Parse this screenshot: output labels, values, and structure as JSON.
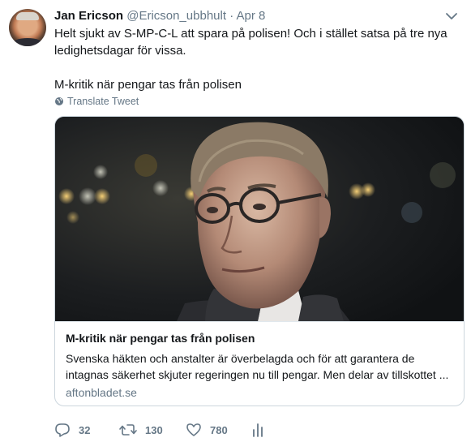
{
  "tweet": {
    "author_name": "Jan Ericson",
    "handle": "@Ericson_ubbhult",
    "separator": "·",
    "date": "Apr 8",
    "text_line1": "Helt sjukt av S-MP-C-L att spara på polisen! Och i stället satsa på tre nya",
    "text_line2": "ledighetsdagar för vissa.",
    "text_line3": "M-kritik när pengar tas från polisen",
    "translate_label": "Translate Tweet"
  },
  "card": {
    "title": "M-kritik när pengar tas från polisen",
    "description_line1": "Svenska häkten och anstalter är överbelagda och för att garantera de",
    "description_line2": "intagnas säkerhet skjuter regeringen nu till pengar. Men delar av tillskottet ...",
    "domain": "aftonbladet.se"
  },
  "actions": {
    "reply_count": "32",
    "retweet_count": "130",
    "like_count": "780"
  },
  "icons": {
    "caret": "chevron-down-icon",
    "translate": "globe-icon",
    "reply": "reply-icon",
    "retweet": "retweet-icon",
    "like": "heart-icon",
    "analytics": "analytics-icon"
  },
  "colors": {
    "text": "#14171a",
    "muted": "#657786",
    "border": "#ccd6dd"
  }
}
